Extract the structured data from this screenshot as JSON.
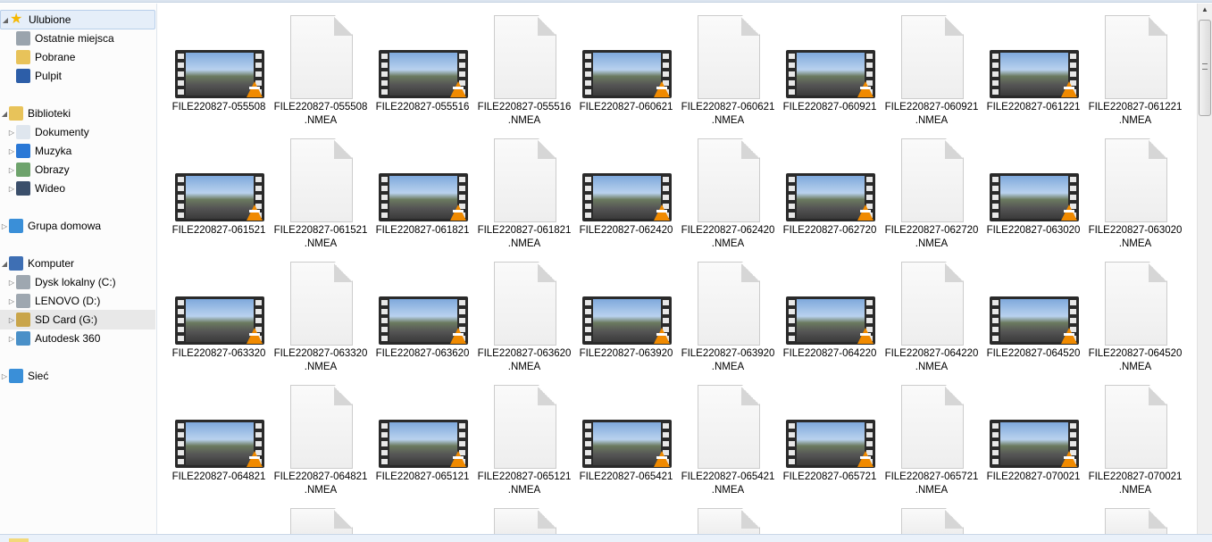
{
  "nav": [
    {
      "label": "Ulubione",
      "icon": "star-icon",
      "level": 0,
      "expander": "open",
      "state": "selected",
      "color": "#f5b800"
    },
    {
      "label": "Ostatnie miejsca",
      "icon": "recent-places-icon",
      "level": 1,
      "expander": "none",
      "color": "#9aa4ad"
    },
    {
      "label": "Pobrane",
      "icon": "downloads-folder-icon",
      "level": 1,
      "expander": "none",
      "color": "#e8c35a"
    },
    {
      "label": "Pulpit",
      "icon": "desktop-icon",
      "level": 1,
      "expander": "none",
      "color": "#2d5ea8"
    },
    {
      "label": "Biblioteki",
      "icon": "libraries-icon",
      "level": 0,
      "expander": "open",
      "color": "#e8c35a",
      "gap": true
    },
    {
      "label": "Dokumenty",
      "icon": "documents-icon",
      "level": 1,
      "expander": "closed",
      "color": "#dfe6ee"
    },
    {
      "label": "Muzyka",
      "icon": "music-icon",
      "level": 1,
      "expander": "closed",
      "color": "#2a78d6"
    },
    {
      "label": "Obrazy",
      "icon": "pictures-icon",
      "level": 1,
      "expander": "closed",
      "color": "#6ea36c"
    },
    {
      "label": "Wideo",
      "icon": "video-icon",
      "level": 1,
      "expander": "closed",
      "color": "#3b4f6b"
    },
    {
      "label": "Grupa domowa",
      "icon": "homegroup-icon",
      "level": 0,
      "expander": "closed",
      "color": "#3a8fd8",
      "gap": true
    },
    {
      "label": "Komputer",
      "icon": "computer-icon",
      "level": 0,
      "expander": "open",
      "color": "#3e6fb4",
      "gap": true
    },
    {
      "label": "Dysk lokalny (C:)",
      "icon": "local-disk-icon",
      "level": 1,
      "expander": "closed",
      "color": "#9ea7b0"
    },
    {
      "label": "LENOVO (D:)",
      "icon": "drive-icon",
      "level": 1,
      "expander": "closed",
      "color": "#9ea7b0"
    },
    {
      "label": "SD Card (G:)",
      "icon": "sd-card-icon",
      "level": 1,
      "expander": "closed",
      "state": "highlighted",
      "color": "#c9a54a"
    },
    {
      "label": "Autodesk 360",
      "icon": "cloud-icon",
      "level": 1,
      "expander": "closed",
      "color": "#4a90c8"
    },
    {
      "label": "Sieć",
      "icon": "network-icon",
      "level": 0,
      "expander": "closed",
      "color": "#3a8fd8",
      "gap": true
    }
  ],
  "file_prefix": "FILE220827-",
  "nmea_ext": ".NMEA",
  "files": [
    "055508",
    "055516",
    "060621",
    "060921",
    "061221",
    "061521",
    "061821",
    "062420",
    "062720",
    "063020",
    "063320",
    "063620",
    "063920",
    "064220",
    "064520",
    "064821",
    "065121",
    "065421",
    "065721",
    "070021"
  ],
  "scrollbar": {
    "position_fraction": 0.0,
    "visible_fraction": 0.2
  }
}
